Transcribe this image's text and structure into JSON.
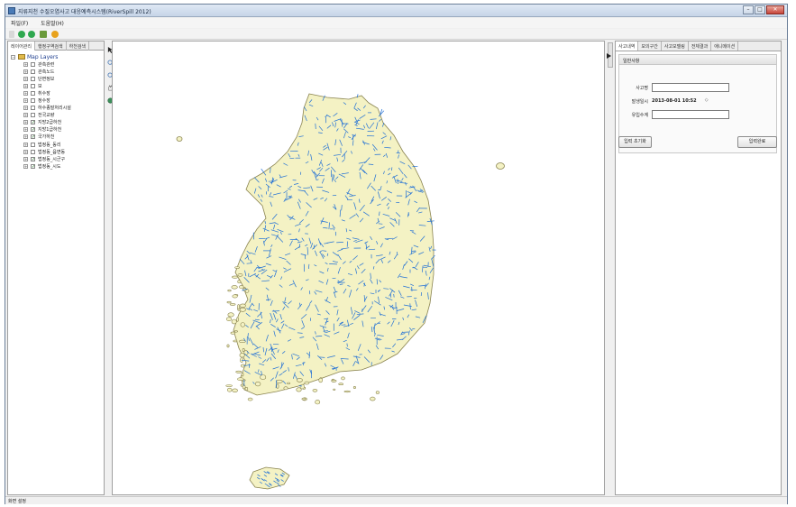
{
  "window": {
    "title": "지류지천 수질오염사고 대응예측시스템(RiverSpill 2012)",
    "controls": [
      "–",
      "□",
      "✕"
    ]
  },
  "menu": [
    "파일(F)",
    "도움말(H)"
  ],
  "toolbar": {
    "icons": [
      "new-icon",
      "zoom-in-icon",
      "zoom-out-icon",
      "layers-icon",
      "globe-icon"
    ],
    "colors": {
      "green": "#2fa84f",
      "orange": "#e8a21c"
    }
  },
  "left_panel": {
    "tabs": [
      "레이어관리",
      "행정구역검색",
      "하천검색"
    ],
    "root_label": "Map Layers",
    "layers": [
      {
        "label": "관측관련",
        "checked": false
      },
      {
        "label": "관측노드",
        "checked": false
      },
      {
        "label": "단면정보",
        "checked": false
      },
      {
        "label": "보",
        "checked": false
      },
      {
        "label": "취수장",
        "checked": false
      },
      {
        "label": "정수장",
        "checked": false
      },
      {
        "label": "하수종말처리시설",
        "checked": false
      },
      {
        "label": "전국교량",
        "checked": false
      },
      {
        "label": "지방2급하천",
        "checked": true
      },
      {
        "label": "지방1급하천",
        "checked": true
      },
      {
        "label": "국가하천",
        "checked": true
      },
      {
        "label": "법정동_동리",
        "checked": false
      },
      {
        "label": "법정동_읍면동",
        "checked": false
      },
      {
        "label": "법정동_시군구",
        "checked": true
      },
      {
        "label": "법정동_시도",
        "checked": true
      }
    ]
  },
  "map_tools": [
    "pointer-icon",
    "zoom-in-icon",
    "zoom-out-icon",
    "pan-icon",
    "full-extent-icon"
  ],
  "map": {
    "land_color": "#f4f2c4",
    "coast_color": "#8a8450",
    "river_color": "#1f6fd6"
  },
  "right_panel": {
    "tabs": [
      "사고내역",
      "모의구간",
      "사고모델링",
      "전체결과",
      "애니메이션"
    ],
    "section": "일반사항",
    "fields": {
      "accident_name_label": "사고명",
      "accident_name_value": "",
      "datetime_label": "발생일시",
      "datetime_value": "2013-08-01 10:52",
      "discharge_label": "유입수계",
      "discharge_value": ""
    },
    "buttons": {
      "reset": "입력 초기화",
      "complete": "입력완료"
    }
  },
  "status": "화면 설정"
}
